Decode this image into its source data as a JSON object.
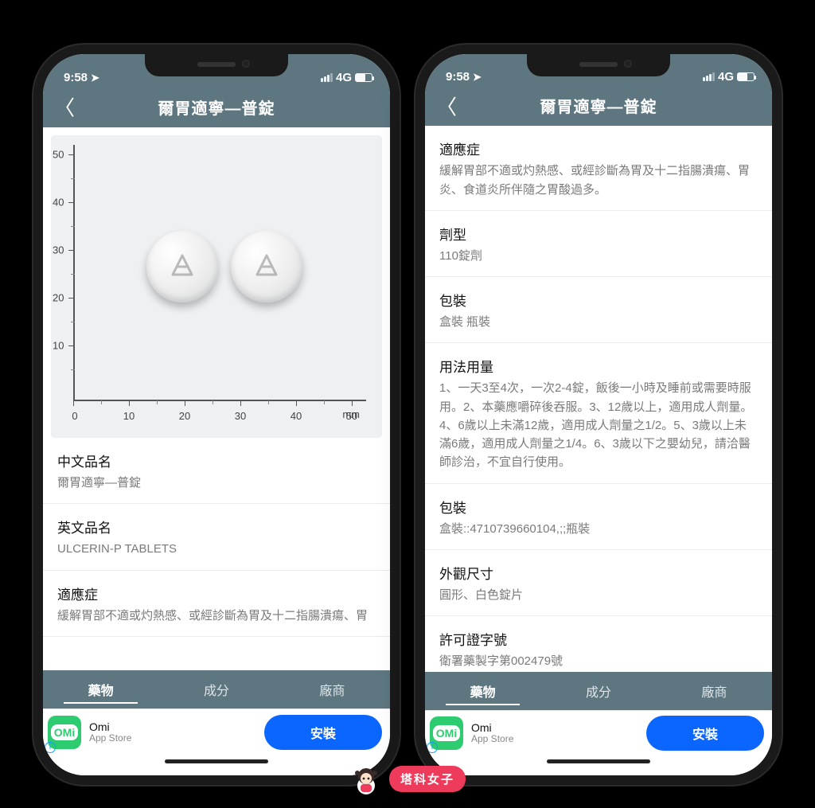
{
  "statusbar": {
    "time": "9:58",
    "network": "4G"
  },
  "navbar": {
    "title": "爾胃適寧—普錠"
  },
  "tabs": {
    "drug": "藥物",
    "ingredient": "成分",
    "vendor": "廠商"
  },
  "ad": {
    "name": "Omi",
    "store": "App Store",
    "cta": "安裝",
    "logo": "OMi"
  },
  "watermark": {
    "text": "塔科女子"
  },
  "left": {
    "sections": {
      "cn_name": {
        "label": "中文品名",
        "value": "爾胃適寧—普錠"
      },
      "en_name": {
        "label": "英文品名",
        "value": "ULCERIN-P TABLETS"
      },
      "indication": {
        "label": "適應症",
        "value": "緩解胃部不適或灼熱感、或經診斷為胃及十二指腸潰瘍、胃"
      }
    },
    "ruler": {
      "unit": "mm",
      "y": [
        "50",
        "40",
        "30",
        "20",
        "10"
      ],
      "x": [
        "0",
        "10",
        "20",
        "30",
        "40",
        "50"
      ]
    }
  },
  "right": {
    "sections": {
      "indication": {
        "label": "適應症",
        "value": "緩解胃部不適或灼熱感、或經診斷為胃及十二指腸潰瘍、胃炎、食道炎所伴隨之胃酸過多。"
      },
      "dosage_form": {
        "label": "劑型",
        "value": "110錠劑"
      },
      "package1": {
        "label": "包裝",
        "value": "盒裝 瓶裝"
      },
      "usage": {
        "label": "用法用量",
        "value": "1、一天3至4次，一次2-4錠，飯後一小時及睡前或需要時服用。2、本藥應嚼碎後吞服。3、12歲以上，適用成人劑量。4、6歲以上未滿12歲，適用成人劑量之1/2。5、3歲以上未滿6歲，適用成人劑量之1/4。6、3歲以下之嬰幼兒，請洽醫師診治，不宜自行使用。"
      },
      "package2": {
        "label": "包裝",
        "value": "盒裝::4710739660104,;;瓶裝"
      },
      "appearance": {
        "label": "外觀尺寸",
        "value": "圓形、白色錠片"
      },
      "license": {
        "label": "許可證字號",
        "value": "衛署藥製字第002479號"
      }
    }
  }
}
